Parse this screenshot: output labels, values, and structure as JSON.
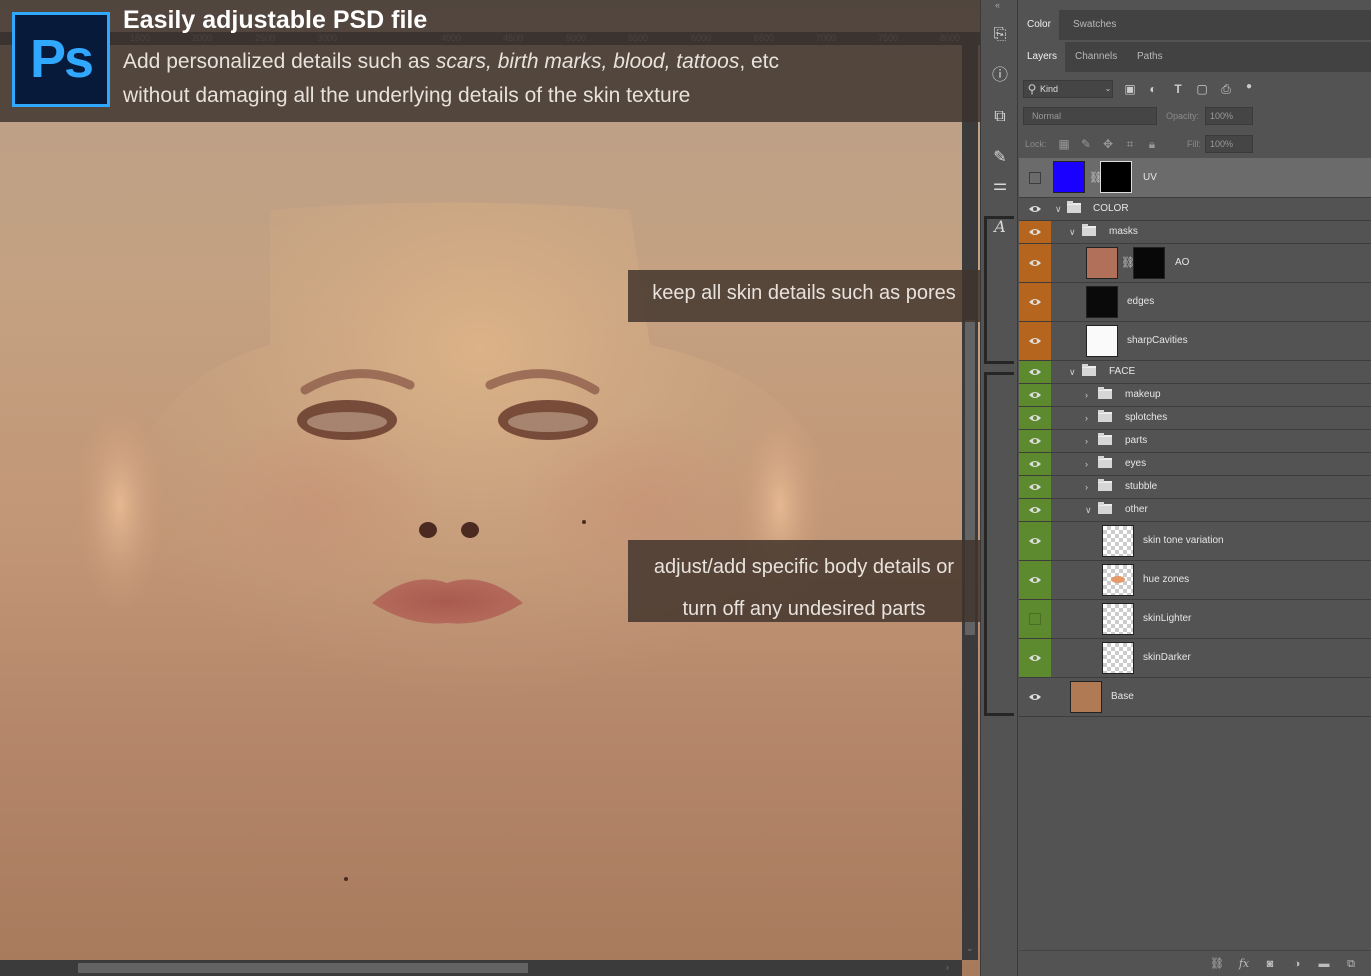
{
  "banner": {
    "logo_text": "Ps",
    "title": "Easily adjustable PSD file",
    "line1_prefix": "Add personalized details such as ",
    "line1_italic": "scars, birth marks, blood, tattoos",
    "line1_suffix": ", etc",
    "line2": "without damaging all the underlying details of the skin texture"
  },
  "callouts": {
    "first": "keep all skin details such as pores",
    "second_line1": "adjust/add specific body details or",
    "second_line2": "turn off any undesired parts"
  },
  "ruler": {
    "ticks": [
      "1500",
      "2000",
      "2500",
      "3000",
      "4000",
      "4500",
      "5000",
      "5500",
      "6000",
      "6500",
      "7000",
      "7500",
      "8000"
    ]
  },
  "tools": {
    "icons": [
      "history-brush-icon",
      "info-icon",
      "properties-icon",
      "brush-presets-icon",
      "adjustments-icon",
      "glyphs-icon"
    ],
    "glyph_label": "A"
  },
  "panel": {
    "top_tabs": [
      "Color",
      "Swatches"
    ],
    "layer_tabs": [
      "Layers",
      "Channels",
      "Paths"
    ],
    "filter_kind": "Kind",
    "blend_mode": "Normal",
    "opacity_label": "Opacity:",
    "opacity_value": "100%",
    "lock_label": "Lock:",
    "fill_label": "Fill:",
    "fill_value": "100%"
  },
  "layers": [
    {
      "name": "UV",
      "type": "layer-mask",
      "visible": false,
      "color": "none"
    },
    {
      "name": "COLOR",
      "type": "group",
      "visible": true,
      "color": "none"
    },
    {
      "name": "masks",
      "type": "group",
      "visible": true,
      "color": "orange"
    },
    {
      "name": "AO",
      "type": "layer-mask",
      "visible": true,
      "color": "orange"
    },
    {
      "name": "edges",
      "type": "layer",
      "visible": true,
      "color": "orange"
    },
    {
      "name": "sharpCavities",
      "type": "layer",
      "visible": true,
      "color": "orange"
    },
    {
      "name": "FACE",
      "type": "group",
      "visible": true,
      "color": "green"
    },
    {
      "name": "makeup",
      "type": "group",
      "visible": true,
      "color": "green"
    },
    {
      "name": "splotches",
      "type": "group",
      "visible": true,
      "color": "green"
    },
    {
      "name": "parts",
      "type": "group",
      "visible": true,
      "color": "green"
    },
    {
      "name": "eyes",
      "type": "group",
      "visible": true,
      "color": "green"
    },
    {
      "name": "stubble",
      "type": "group",
      "visible": true,
      "color": "green"
    },
    {
      "name": "other",
      "type": "group",
      "visible": true,
      "color": "green"
    },
    {
      "name": "skin tone variation",
      "type": "layer",
      "visible": true,
      "color": "green"
    },
    {
      "name": "hue zones",
      "type": "layer",
      "visible": true,
      "color": "green"
    },
    {
      "name": "skinLighter",
      "type": "layer",
      "visible": false,
      "color": "green"
    },
    {
      "name": "skinDarker",
      "type": "layer",
      "visible": true,
      "color": "green"
    },
    {
      "name": "Base",
      "type": "layer",
      "visible": true,
      "color": "none"
    }
  ],
  "colors": {
    "orange_label": "#b5651d",
    "green_label": "#5d8a2f",
    "uv_thumb": "#1a00ff",
    "ao_thumb": "#b0705a",
    "base_thumb": "#b07a55",
    "ps_blue": "#31a8ff"
  }
}
